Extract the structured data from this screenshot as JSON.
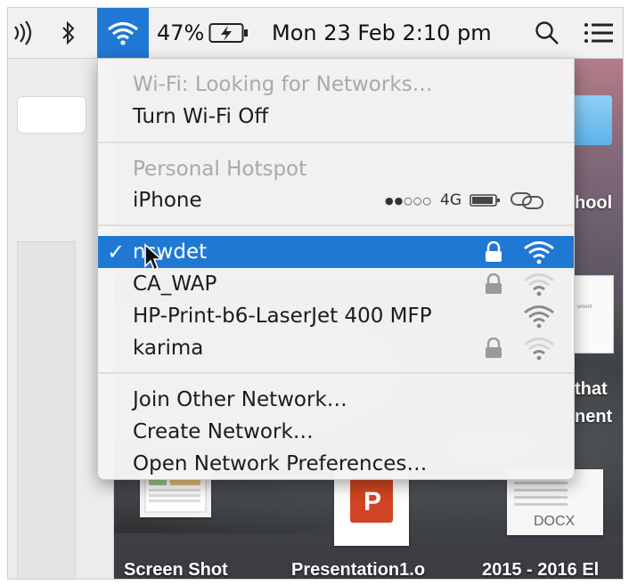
{
  "menubar": {
    "volume_icon": "volume-icon",
    "bluetooth_icon": "bluetooth-icon",
    "wifi_icon": "wifi-icon",
    "battery_percent": "47%",
    "battery_icon": "battery-charging-icon",
    "datetime": "Mon 23 Feb  2:10 pm",
    "search_icon": "spotlight-search-icon",
    "notifications_icon": "notification-center-icon"
  },
  "wifi_menu": {
    "status": "Wi-Fi: Looking for Networks…",
    "toggle_label": "Turn Wi-Fi Off",
    "hotspot_header": "Personal Hotspot",
    "hotspot": {
      "name": "iPhone",
      "signal_dots": "●●○○○",
      "network_type": "4G"
    },
    "networks": [
      {
        "name": "nswdet",
        "selected": true,
        "locked": true,
        "strength": "full"
      },
      {
        "name": "CA_WAP",
        "selected": false,
        "locked": true,
        "strength": "weak"
      },
      {
        "name": "HP-Print-b6-LaserJet 400 MFP",
        "selected": false,
        "locked": false,
        "strength": "medium"
      },
      {
        "name": "karima",
        "selected": false,
        "locked": true,
        "strength": "weak"
      }
    ],
    "check_mark": "✓",
    "actions": {
      "join_other": "Join Other Network…",
      "create": "Create Network…",
      "open_prefs": "Open Network Preferences…"
    }
  },
  "desktop": {
    "side_labels": [
      "hool",
      "that",
      "nent"
    ],
    "files": [
      {
        "label": "Screen Shot"
      },
      {
        "label": "Presentation1.o"
      },
      {
        "label": "2015 - 2016 El"
      }
    ],
    "ppt_letter": "P",
    "docx_label": "DOCX",
    "doc_thumb_text": "ument"
  },
  "colors": {
    "highlight": "#1f78d4",
    "menu_bg": "#f4f4f4",
    "disabled_text": "#a9a9a9"
  }
}
